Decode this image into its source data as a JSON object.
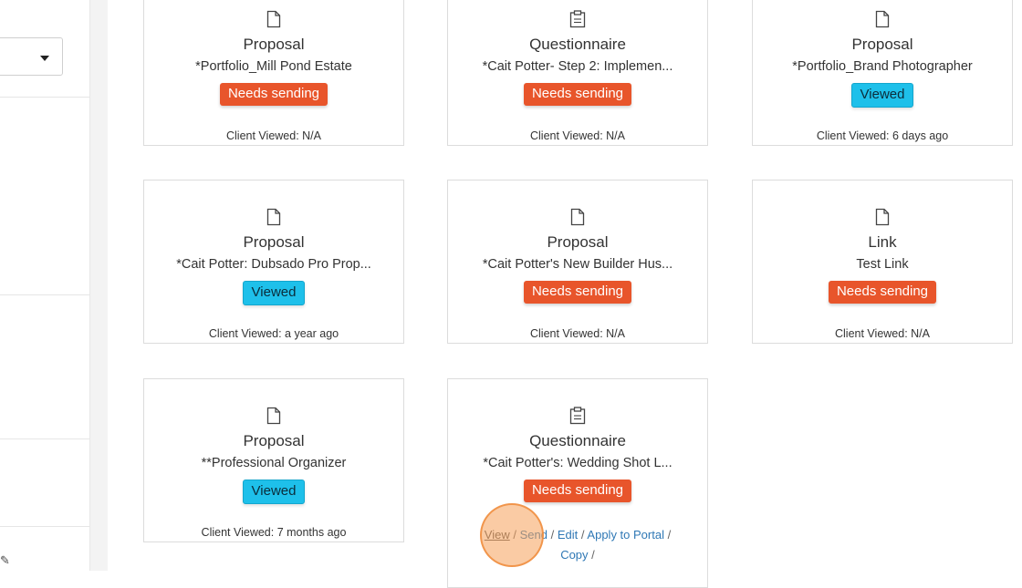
{
  "cards": [
    {
      "icon": "document-icon",
      "type": "Proposal",
      "name": "*Portfolio_Mill Pond Estate",
      "status": "Needs sending",
      "status_kind": "needs",
      "viewed": "Client Viewed: N/A"
    },
    {
      "icon": "clipboard-icon",
      "type": "Questionnaire",
      "name": "*Cait Potter- Step 2: Implemen...",
      "status": "Needs sending",
      "status_kind": "needs",
      "viewed": "Client Viewed: N/A"
    },
    {
      "icon": "document-icon",
      "type": "Proposal",
      "name": "*Portfolio_Brand Photographer",
      "status": "Viewed",
      "status_kind": "viewed",
      "viewed": "Client Viewed: 6 days ago"
    },
    {
      "icon": "document-icon",
      "type": "Proposal",
      "name": "*Cait Potter: Dubsado Pro Prop...",
      "status": "Viewed",
      "status_kind": "viewed",
      "viewed": "Client Viewed: a year ago"
    },
    {
      "icon": "document-icon",
      "type": "Proposal",
      "name": "*Cait Potter's New Builder Hus...",
      "status": "Needs sending",
      "status_kind": "needs",
      "viewed": "Client Viewed: N/A"
    },
    {
      "icon": "document-icon",
      "type": "Link",
      "name": "Test Link",
      "status": "Needs sending",
      "status_kind": "needs",
      "viewed": "Client Viewed: N/A"
    },
    {
      "icon": "document-icon",
      "type": "Proposal",
      "name": "**Professional Organizer",
      "status": "Viewed",
      "status_kind": "viewed",
      "viewed": "Client Viewed: 7 months ago"
    },
    {
      "icon": "clipboard-icon",
      "type": "Questionnaire",
      "name": "*Cait Potter's: Wedding Shot L...",
      "status": "Needs sending",
      "status_kind": "needs",
      "viewed": ""
    }
  ],
  "hover_actions": {
    "view": "View",
    "send": "Send",
    "edit": "Edit",
    "apply_to_portal": "Apply to Portal",
    "copy": "Copy",
    "sep": "/"
  },
  "colors": {
    "needs_sending": "#e8552b",
    "viewed": "#1ec0ea",
    "link": "#2f78b5"
  }
}
